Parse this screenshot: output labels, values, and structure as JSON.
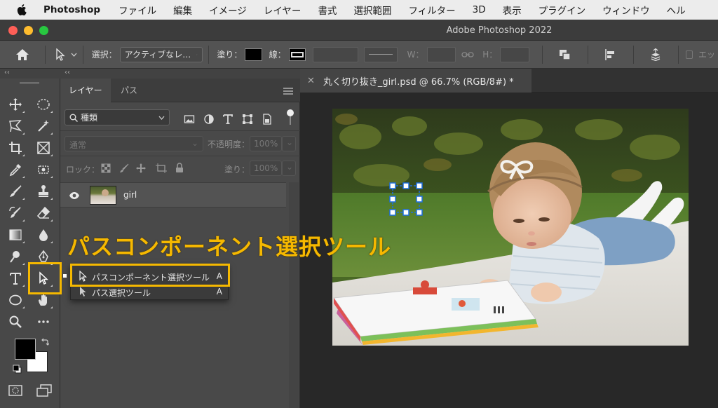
{
  "menubar": {
    "app_name": "Photoshop",
    "items": [
      "ファイル",
      "編集",
      "イメージ",
      "レイヤー",
      "書式",
      "選択範囲",
      "フィルター",
      "3D",
      "表示",
      "プラグイン",
      "ウィンドウ",
      "ヘル"
    ]
  },
  "window": {
    "title": "Adobe Photoshop 2022"
  },
  "options_bar": {
    "select_label": "選択：",
    "select_value": "アクティブなレ…",
    "fill_label": "塗り：",
    "stroke_label": "線：",
    "w_label": "W：",
    "h_label": "H：",
    "more_label": "エッ"
  },
  "layers_panel": {
    "tabs": [
      "レイヤー",
      "パス"
    ],
    "filter_value": "種類",
    "blend_mode": "通常",
    "opacity_label": "不透明度：",
    "opacity_value": "100%",
    "lock_label": "ロック：",
    "fill_label": "塗り：",
    "fill_value": "100%",
    "layers": [
      {
        "name": "girl"
      }
    ]
  },
  "flyout": {
    "items": [
      {
        "label": "パスコンポーネント選択ツール",
        "key": "A"
      },
      {
        "label": "パス選択ツール",
        "key": "A"
      }
    ]
  },
  "annotation": {
    "callout": "パスコンポーネント選択ツール",
    "highlight_color": "#f5b800"
  },
  "document": {
    "tab_title": "丸く切り抜き_girl.psd @ 66.7% (RGB/8#) *"
  },
  "colors": {
    "foreground": "#000000",
    "background": "#ffffff",
    "selection_handles": "#1e6fe0"
  }
}
